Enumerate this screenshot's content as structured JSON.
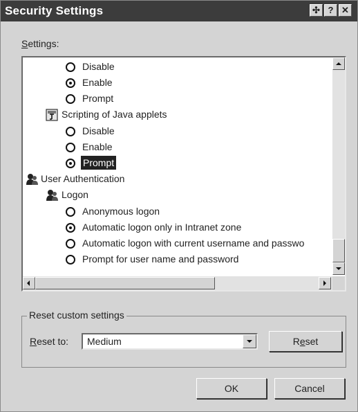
{
  "window": {
    "title": "Security Settings",
    "title_buttons": {
      "move": "✣",
      "help": "?",
      "close": "✕"
    }
  },
  "settings": {
    "label_underline": "S",
    "label_rest": "ettings:",
    "items": [
      {
        "kind": "radio",
        "label": "Disable",
        "selected": false
      },
      {
        "kind": "radio",
        "label": "Enable",
        "selected": true
      },
      {
        "kind": "radio",
        "label": "Prompt",
        "selected": false
      },
      {
        "kind": "category",
        "label": "Scripting of Java applets",
        "icon": "java-scripting-icon"
      },
      {
        "kind": "radio",
        "label": "Disable",
        "selected": false
      },
      {
        "kind": "radio",
        "label": "Enable",
        "selected": false
      },
      {
        "kind": "radio",
        "label": "Prompt",
        "selected": true,
        "highlighted": true
      },
      {
        "kind": "group",
        "label": "User Authentication",
        "icon": "user-authentication-icon"
      },
      {
        "kind": "category",
        "label": "Logon",
        "icon": "logon-icon"
      },
      {
        "kind": "radio",
        "label": "Anonymous logon",
        "selected": false
      },
      {
        "kind": "radio",
        "label": "Automatic logon only in Intranet zone",
        "selected": true
      },
      {
        "kind": "radio",
        "label": "Automatic logon with current username and passwo",
        "selected": false
      },
      {
        "kind": "radio",
        "label": "Prompt for user name and password",
        "selected": false
      }
    ]
  },
  "reset": {
    "group_title": "Reset custom settings",
    "reset_to_underline": "R",
    "reset_to_rest": "eset to:",
    "selected_level": "Medium",
    "reset_button_pre": "R",
    "reset_button_underline": "e",
    "reset_button_post": "set"
  },
  "footer": {
    "ok_label": "OK",
    "cancel_label": "Cancel"
  },
  "colors": {
    "titlebar": "#3c3c3c",
    "dialog_face": "#d4d4d4",
    "highlight": "#222222"
  }
}
